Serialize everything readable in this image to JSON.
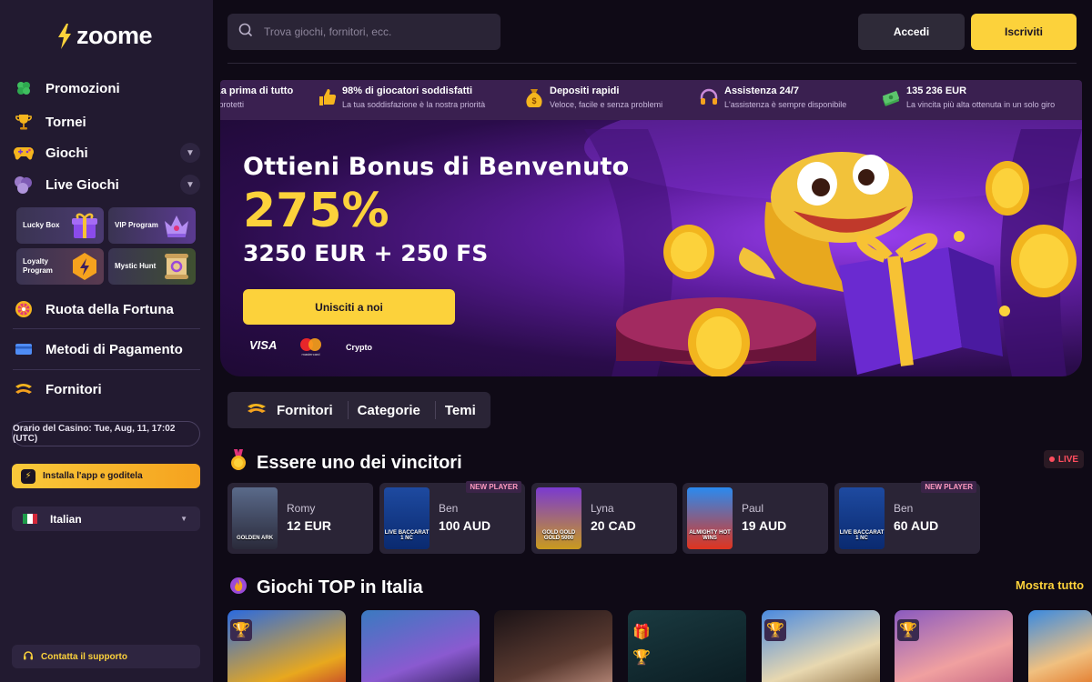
{
  "brand": {
    "name": "zoome"
  },
  "sidebar": {
    "nav": [
      {
        "label": "Promozioni",
        "icon": "clover-icon"
      },
      {
        "label": "Tornei",
        "icon": "trophy-icon"
      },
      {
        "label": "Giochi",
        "icon": "gamepad-icon"
      },
      {
        "label": "Live Giochi",
        "icon": "cards-icon"
      }
    ],
    "tiles": [
      {
        "label": "Lucky Box",
        "icon": "gift-box-icon"
      },
      {
        "label": "VIP Program",
        "icon": "crown-icon"
      },
      {
        "label": "Loyalty Program",
        "icon": "lightning-badge-icon"
      },
      {
        "label": "Mystic Hunt",
        "icon": "scroll-icon"
      }
    ],
    "nav2": [
      {
        "label": "Ruota della Fortuna",
        "icon": "wheel-icon"
      },
      {
        "label": "Metodi di Pagamento",
        "icon": "credit-card-icon"
      },
      {
        "label": "Fornitori",
        "icon": "providers-icon"
      }
    ],
    "clock": "Orario del Casino: Tue, Aug, 11, 17:02 (UTC)",
    "install": "Installa l'app e goditela",
    "language": "Italian",
    "support": "Contatta il supporto"
  },
  "header": {
    "search_placeholder": "Trova giochi, fornitori, ecc.",
    "login": "Accedi",
    "signup": "Iscriviti"
  },
  "ticker": [
    {
      "title": "La prima di tutto",
      "sub": "i protetti",
      "icon": "shield-icon"
    },
    {
      "title": "98% di giocatori soddisfatti",
      "sub": "La tua soddisfazione è la nostra priorità",
      "icon": "thumbs-up-icon"
    },
    {
      "title": "Depositi rapidi",
      "sub": "Veloce, facile e senza problemi",
      "icon": "money-bag-icon"
    },
    {
      "title": "Assistenza 24/7",
      "sub": "L'assistenza è sempre disponibile",
      "icon": "headset-icon"
    },
    {
      "title": "135 236 EUR",
      "sub": "La vincita più alta ottenuta in un solo giro",
      "icon": "cash-stack-icon"
    }
  ],
  "hero": {
    "title": "Ottieni Bonus di Benvenuto",
    "percent": "275%",
    "amount": "3250 EUR + 250 FS",
    "cta": "Unisciti a noi",
    "payments": {
      "visa": "VISA",
      "mastercard": "mastercard",
      "crypto": "Crypto"
    }
  },
  "tabs": [
    "Fornitori",
    "Categorie",
    "Temi"
  ],
  "winners": {
    "title": "Essere uno dei vincitori",
    "live": "LIVE",
    "items": [
      {
        "name": "Romy",
        "amount": "12 EUR",
        "game": "GOLDEN ARK",
        "new_player": ""
      },
      {
        "name": "Ben",
        "amount": "100 AUD",
        "game": "LIVE BACCARAT 1 NC",
        "new_player": "NEW PLAYER"
      },
      {
        "name": "Lyna",
        "amount": "20 CAD",
        "game": "GOLD GOLD GOLD 5000",
        "new_player": ""
      },
      {
        "name": "Paul",
        "amount": "19 AUD",
        "game": "ALMIGHTY HOT WINS",
        "new_player": ""
      },
      {
        "name": "Ben",
        "amount": "60 AUD",
        "game": "LIVE BACCARAT 1 NC",
        "new_player": "NEW PLAYER"
      }
    ]
  },
  "top_games": {
    "title": "Giochi TOP in Italia",
    "show_all": "Mostra tutto"
  },
  "colors": {
    "accent": "#fcd23b",
    "sidebar": "#221a30",
    "background": "#0f0a16",
    "live": "#ff4d5e"
  }
}
